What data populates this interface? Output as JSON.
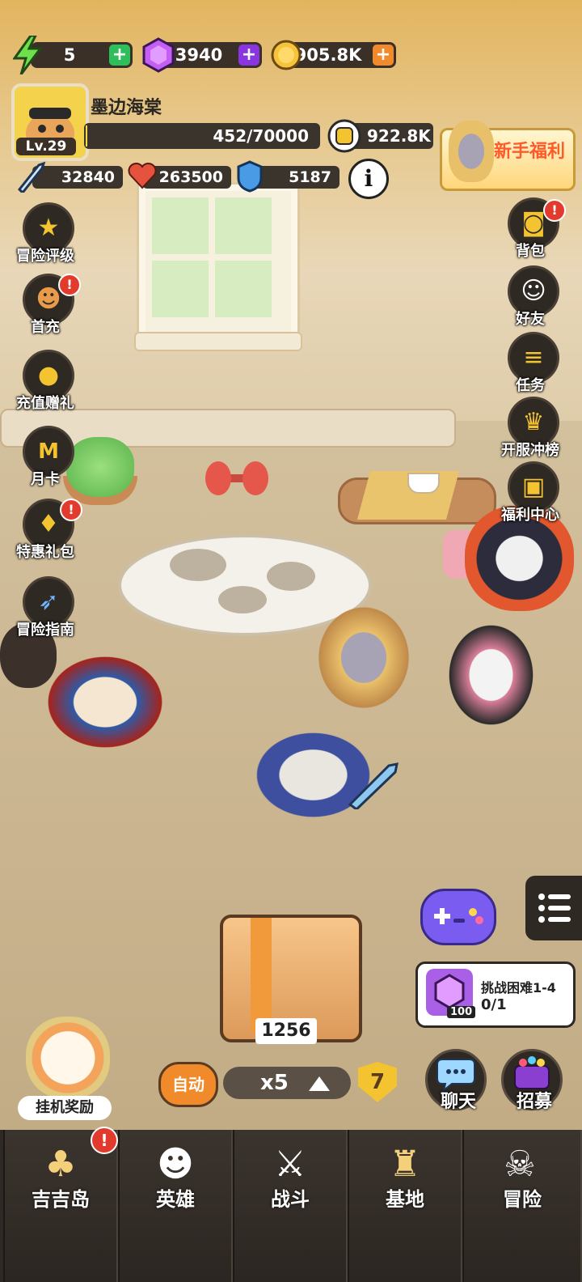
{
  "resources": {
    "energy": "5",
    "gems": "3940",
    "gold": "905.8K"
  },
  "player": {
    "name": "墨边海棠",
    "level": "Lv.29",
    "exp": "452/70000",
    "exp_fraction": 0.0065,
    "power": "922.8K",
    "attack": "32840",
    "hp": "263500",
    "defense": "5187"
  },
  "newbie_banner": "新手福利",
  "left_menu": [
    {
      "label": "冒险评级",
      "icon": "star-badge-icon",
      "badge": ""
    },
    {
      "label": "首充",
      "icon": "hero-portrait-icon",
      "badge": "!"
    },
    {
      "label": "充值赠礼",
      "icon": "money-bag-icon",
      "badge": ""
    },
    {
      "label": "月卡",
      "icon": "month-card-icon",
      "badge": ""
    },
    {
      "label": "特惠礼包",
      "icon": "gift-chest-icon",
      "badge": "!"
    },
    {
      "label": "冒险指南",
      "icon": "rocket-icon",
      "badge": ""
    }
  ],
  "right_menu": [
    {
      "label": "背包",
      "icon": "backpack-icon",
      "badge": "!"
    },
    {
      "label": "好友",
      "icon": "friends-icon",
      "badge": ""
    },
    {
      "label": "任务",
      "icon": "scroll-icon",
      "badge": ""
    },
    {
      "label": "开服冲榜",
      "icon": "trophy-icon",
      "badge": ""
    },
    {
      "label": "福利中心",
      "icon": "gift-box-icon",
      "badge": ""
    }
  ],
  "chest": {
    "count": "1256"
  },
  "controls": {
    "auto_label": "自动",
    "speed_label": "x5",
    "shield_value": "7"
  },
  "task": {
    "title": "挑战困难1-4",
    "progress": "0/1",
    "reward": "100"
  },
  "chat_label": "聊天",
  "recruit_label": "招募",
  "idle_reward_label": "挂机奖励",
  "nav": [
    {
      "label": "吉吉岛",
      "icon": "palm-island-icon",
      "badge": "!"
    },
    {
      "label": "英雄",
      "icon": "hero-cat-icon",
      "badge": ""
    },
    {
      "label": "战斗",
      "icon": "crossed-swords-icon",
      "badge": ""
    },
    {
      "label": "基地",
      "icon": "base-tower-icon",
      "badge": ""
    },
    {
      "label": "冒险",
      "icon": "skull-flame-icon",
      "badge": ""
    }
  ],
  "colors": {
    "energy_plus": "#2fbf5a",
    "gem_plus": "#8a35e0",
    "gold_plus": "#f08a2a",
    "badge": "#e23b2e",
    "auto_button": "#f08a2a"
  }
}
